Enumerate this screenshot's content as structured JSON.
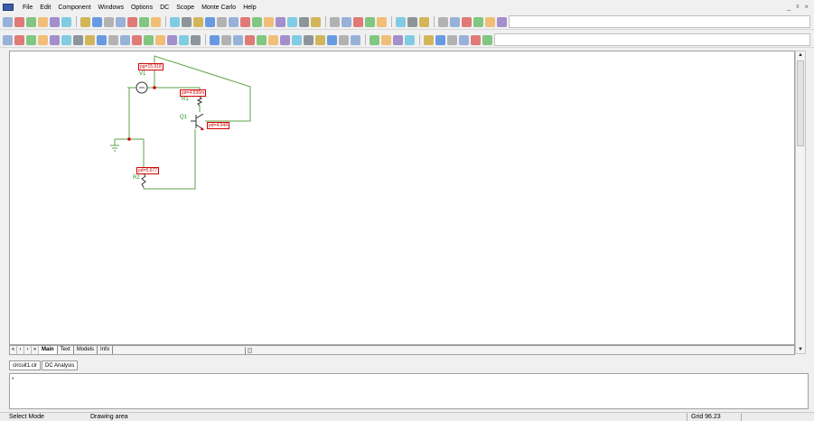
{
  "menu": [
    "File",
    "Edit",
    "Component",
    "Windows",
    "Options",
    "DC",
    "Scope",
    "Monte Carlo",
    "Help"
  ],
  "window_controls": [
    "_",
    "ᵍ",
    "×"
  ],
  "toolbar1_icons": [
    "new-icon",
    "open-icon",
    "save-icon",
    "save-all-icon",
    "print-icon",
    "print-preview-icon",
    "sep",
    "undo-icon",
    "redo-icon",
    "cut-icon",
    "copy-icon",
    "paste-icon",
    "delete-icon",
    "select-all-icon",
    "sep",
    "ground-icon",
    "resistor-icon",
    "capacitor-icon",
    "inductor-icon",
    "diode-icon",
    "transistor-npn-icon",
    "transistor-pnp-icon",
    "mosfet-icon",
    "opamp-icon",
    "battery-icon",
    "wire-icon",
    "source-icon",
    "switch-icon",
    "sep",
    "grid-icon",
    "window-icon",
    "tile-icon",
    "split-icon",
    "panel-icon",
    "sep",
    "probe-icon",
    "pin-icon",
    "library-icon",
    "sep",
    "find-icon",
    "list-icon",
    "meter-icon",
    "zoom-icon",
    "tools-icon",
    "settings-icon"
  ],
  "toolbar2_icons": [
    "select-icon",
    "point-icon",
    "wire-mode-icon",
    "text-icon",
    "arrow-icon",
    "line-icon",
    "graphics-icon",
    "component-icon",
    "flag-icon",
    "pick-icon",
    "info-icon",
    "pin-icon",
    "layers-icon",
    "tag-icon",
    "node-icon",
    "title-icon",
    "box-icon",
    "sep",
    "stepping-icon",
    "plot-icon",
    "analysis-icon",
    "sweep-icon",
    "warning-icon",
    "calc-icon",
    "color-icon",
    "zoomin-icon",
    "zoomout-icon",
    "fit-icon",
    "refresh-icon",
    "find-icon",
    "check-icon",
    "sep",
    "run-icon",
    "stop-icon",
    "pause-icon",
    "bell-icon",
    "sep",
    "prev-icon",
    "next-icon",
    "tile-horizontal-icon",
    "tile-vertical-icon",
    "font-icon",
    "color-pick-icon"
  ],
  "schematic": {
    "v1_label": "V1",
    "v1_probe": "pg=15.918",
    "r1_label": "R1",
    "r1_probe": "pd=4.536m",
    "q1_label": "Q1",
    "q1_probe": "pd=4.044",
    "r2_label": "R2",
    "r2_probe": "pd=5.677"
  },
  "page_tabs": [
    {
      "label": "Main",
      "active": true
    },
    {
      "label": "Text",
      "active": false
    },
    {
      "label": "Models",
      "active": false
    },
    {
      "label": "Info",
      "active": false
    }
  ],
  "doc_tabs": [
    "circuit1.cir",
    "DC Analysis"
  ],
  "output_marker": "*",
  "status": {
    "mode": "Select Mode",
    "hint": "Drawing area",
    "grid": "Grid 96.23"
  }
}
